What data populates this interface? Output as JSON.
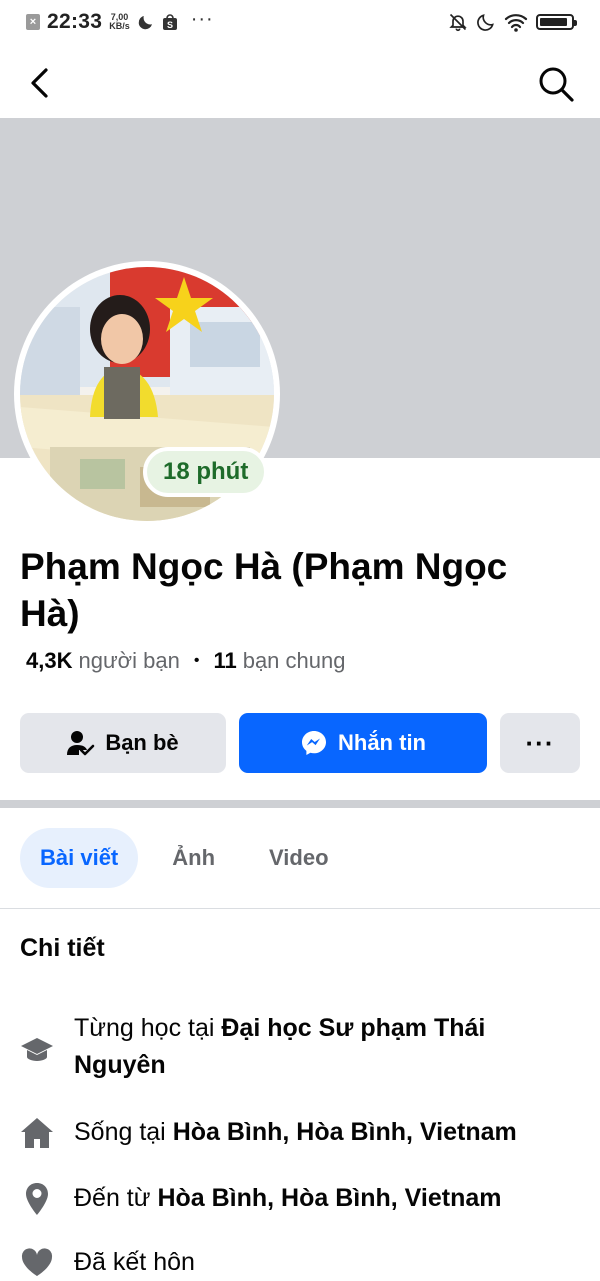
{
  "status_bar": {
    "time": "22:33",
    "net_speed_value": "7,00",
    "net_speed_unit": "KB/s",
    "battery_level": 0.9,
    "icons": [
      "close-notification-icon",
      "moon-icon",
      "shopee-icon",
      "more-dots-icon",
      "bell-off-icon",
      "moon-icon",
      "wifi-icon",
      "battery-icon"
    ]
  },
  "nav": {
    "icons": [
      "back-icon",
      "search-icon"
    ]
  },
  "profile": {
    "active_status": "18 phút",
    "name": "Phạm Ngọc Hà (Phạm Ngọc Hà)",
    "friends_count": "4,3K",
    "friends_label": "người bạn",
    "separator": "•",
    "mutual_count": "11",
    "mutual_label": "bạn chung",
    "cover_color": "#ced0d4"
  },
  "actions": {
    "friends_label": "Bạn bè",
    "message_label": "Nhắn tin",
    "more_label": "···",
    "accent": "#0866ff"
  },
  "tabs": [
    {
      "label": "Bài viết",
      "active": true
    },
    {
      "label": "Ảnh",
      "active": false
    },
    {
      "label": "Video",
      "active": false
    }
  ],
  "details": {
    "title": "Chi tiết",
    "items": [
      {
        "icon": "education-cap-icon",
        "prefix": "Từng học tại",
        "value": "Đại học Sư phạm Thái Nguyên"
      },
      {
        "icon": "home-icon",
        "prefix": "Sống tại",
        "value": "Hòa Bình, Hòa Bình, Vietnam"
      },
      {
        "icon": "location-pin-icon",
        "prefix": "Đến từ",
        "value": "Hòa Bình, Hòa Bình, Vietnam"
      },
      {
        "icon": "heart-icon",
        "prefix": "Đã kết hôn",
        "value": ""
      }
    ]
  }
}
